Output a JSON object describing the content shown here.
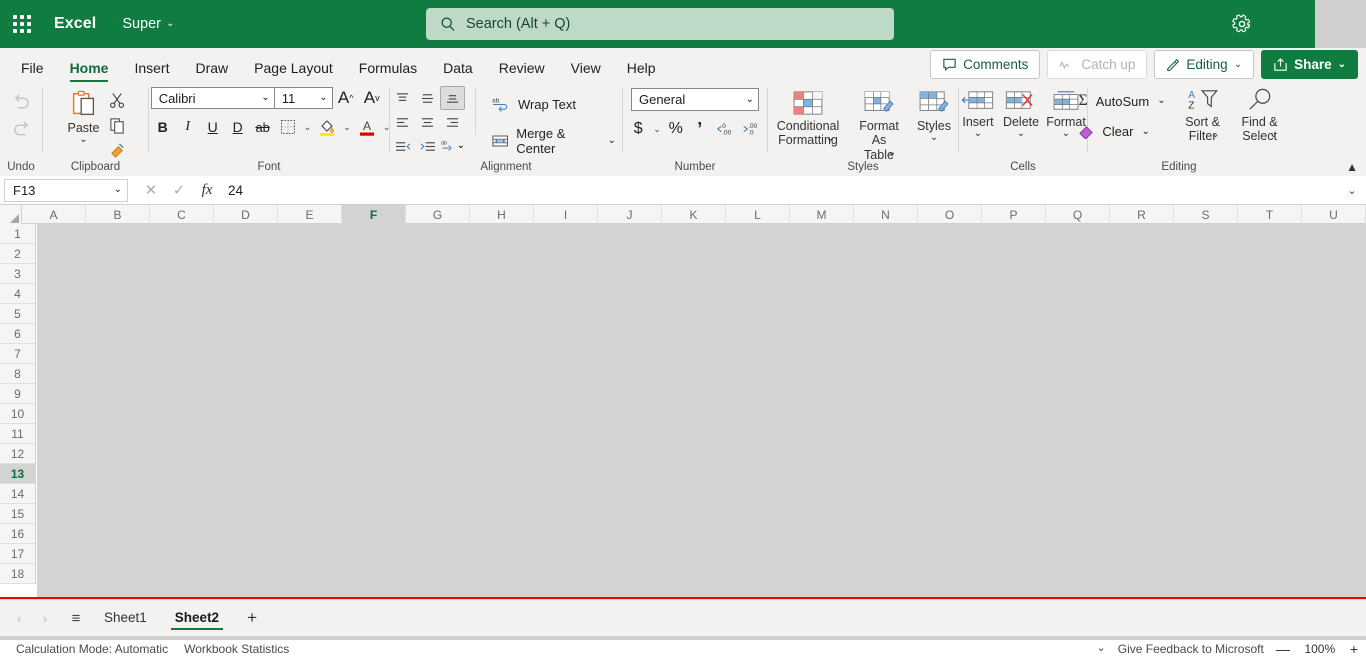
{
  "titlebar": {
    "waffle_tooltip": "App launcher",
    "app_name": "Excel",
    "doc_name": "Super",
    "doc_chevron": "⌄",
    "gear_icon": "settings-gear"
  },
  "search": {
    "placeholder": "Search (Alt + Q)",
    "icon": "search-icon"
  },
  "tabs": [
    {
      "label": "File",
      "active": false
    },
    {
      "label": "Home",
      "active": true
    },
    {
      "label": "Insert",
      "active": false
    },
    {
      "label": "Draw",
      "active": false
    },
    {
      "label": "Page Layout",
      "active": false
    },
    {
      "label": "Formulas",
      "active": false
    },
    {
      "label": "Data",
      "active": false
    },
    {
      "label": "Review",
      "active": false
    },
    {
      "label": "View",
      "active": false
    },
    {
      "label": "Help",
      "active": false
    }
  ],
  "tab_actions": {
    "comments": "Comments",
    "catch_up": "Catch up",
    "editing": "Editing",
    "editing_chevron": "⌄",
    "share": "Share",
    "share_chevron": "⌄"
  },
  "ribbon": {
    "undo": {
      "label": "Undo",
      "undo_icon": "undo-arrow-icon",
      "redo_icon": "redo-arrow-icon"
    },
    "clipboard": {
      "label": "Clipboard",
      "paste": "Paste",
      "paste_chevron": "⌄",
      "cut_icon": "scissors-icon",
      "copy_icon": "copy-icon",
      "format_painter_icon": "format-painter-icon"
    },
    "font": {
      "label": "Font",
      "font_name": "Calibri",
      "font_size": "11",
      "grow_font": "A",
      "shrink_font": "A",
      "bold": "B",
      "italic": "I",
      "underline": "U",
      "double_underline": "D",
      "strikethrough": "ab",
      "borders_icon": "borders-icon",
      "fill_color_icon": "fill-color-icon",
      "font_color_icon": "font-color-icon",
      "chevron": "⌄"
    },
    "alignment": {
      "label": "Alignment",
      "wrap_text": "Wrap Text",
      "merge_center": "Merge & Center",
      "merge_chevron": "⌄",
      "orientation_chevron": "⌄"
    },
    "number": {
      "label": "Number",
      "format": "General",
      "format_chevron": "⌄",
      "currency": "$",
      "currency_chevron": "⌄",
      "percent": "%",
      "comma": "’",
      "increase_decimal": "increase-decimal-icon",
      "decrease_decimal": "decrease-decimal-icon"
    },
    "styles": {
      "label": "Styles",
      "conditional_formatting": "Conditional Formatting",
      "conditional_chevron": "⌄",
      "format_as_table": "Format As Table",
      "table_chevron": "⌄",
      "cell_styles": "Styles",
      "styles_chevron": "⌄"
    },
    "cells": {
      "label": "Cells",
      "insert": "Insert",
      "delete": "Delete",
      "format": "Format",
      "chevron": "⌄"
    },
    "editing": {
      "label": "Editing",
      "autosum": "AutoSum",
      "autosum_chevron": "⌄",
      "clear": "Clear",
      "clear_chevron": "⌄",
      "sort_filter": "Sort & Filter",
      "sort_chevron": "⌄",
      "find_select": "Find & Select",
      "find_chevron": "⌄"
    },
    "collapse_icon": "chevron-up-icon"
  },
  "formula_bar": {
    "name_box": "F13",
    "name_box_chevron": "⌄",
    "cancel_icon": "cancel-x-icon",
    "enter_icon": "enter-check-icon",
    "fx_icon": "fx",
    "value": "24",
    "expand_chevron": "⌄"
  },
  "grid": {
    "columns": [
      "A",
      "B",
      "C",
      "D",
      "E",
      "F",
      "G",
      "H",
      "I",
      "J",
      "K",
      "L",
      "M",
      "N",
      "O",
      "P",
      "Q",
      "R",
      "S",
      "T",
      "U"
    ],
    "selected_column": "F",
    "rows": [
      "1",
      "2",
      "3",
      "4",
      "5",
      "6",
      "7",
      "8",
      "9",
      "10",
      "11",
      "12",
      "13",
      "14",
      "15",
      "16",
      "17",
      "18"
    ],
    "selected_row": "13",
    "selected_cell": "F13"
  },
  "sheets": {
    "prev_icon": "‹",
    "next_icon": "›",
    "all_sheets_icon": "≡",
    "tabs": [
      {
        "label": "Sheet1",
        "active": false
      },
      {
        "label": "Sheet2",
        "active": true
      }
    ],
    "add_label": "+"
  },
  "status": {
    "calculation_mode": "Calculation Mode: Automatic",
    "workbook_statistics": "Workbook Statistics",
    "options_chevron": "⌄",
    "feedback": "Give Feedback to Microsoft",
    "zoom_out": "—",
    "zoom_level": "100%",
    "zoom_in": "+"
  },
  "colors": {
    "brand_green": "#107c41",
    "search_bg": "#bed9c8",
    "ribbon_bg": "#f3f2f1",
    "grid_area": "#d3d3d3",
    "highlight_red": "#ee0000"
  }
}
